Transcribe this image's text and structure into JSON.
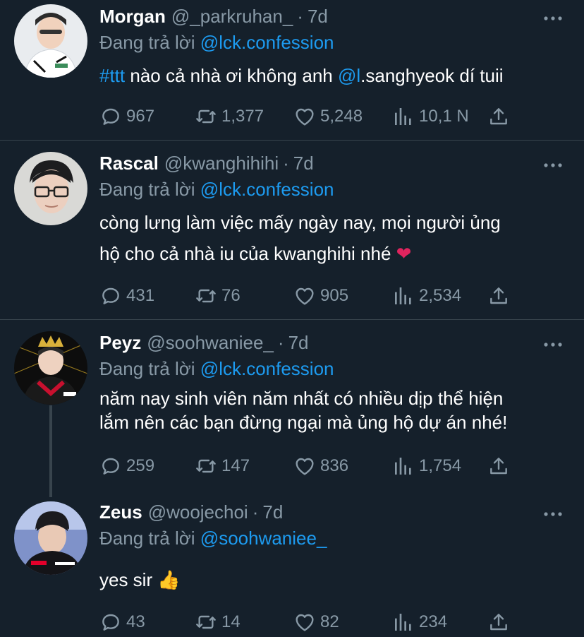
{
  "replying_prefix": "Đang trả lời",
  "tweets": [
    {
      "name": "Morgan",
      "handle": "@_parkruhan_",
      "dot": "·",
      "time": "7d",
      "replying_to": "@lck.confession",
      "text_parts": [
        "#ttt",
        " nào cả nhà ơi không anh ",
        "@l",
        ".sanghyeok dí tuii"
      ],
      "replies": "967",
      "retweets": "1,377",
      "likes": "5,248",
      "views": "10,1 N"
    },
    {
      "name": "Rascal",
      "handle": "@kwanghihihi",
      "dot": "·",
      "time": "7d",
      "replying_to": "@lck.confession",
      "text_line1": "còng lưng làm việc mấy ngày nay, mọi người ủng",
      "text_line2": "hộ cho cả nhà iu của kwanghihi nhé ",
      "emoji": "❤",
      "replies": "431",
      "retweets": "76",
      "likes": "905",
      "views": "2,534"
    },
    {
      "name": "Peyz",
      "handle": "@soohwaniee_",
      "dot": "·",
      "time": "7d",
      "replying_to": "@lck.confession",
      "text_line1": "năm nay sinh viên năm nhất có nhiều dịp thể hiện",
      "text_line2": "lắm nên các bạn đừng ngại mà ủng hộ dự án nhé!",
      "replies": "259",
      "retweets": "147",
      "likes": "836",
      "views": "1,754"
    },
    {
      "name": "Zeus",
      "handle": "@woojechoi",
      "dot": "·",
      "time": "7d",
      "replying_to": "@soohwaniee_",
      "text_line1": "yes sir ",
      "emoji": "👍",
      "replies": "43",
      "retweets": "14",
      "likes": "82",
      "views": "234"
    }
  ],
  "colors": {
    "background": "#15202b",
    "text": "#ffffff",
    "muted": "#8899a6",
    "link": "#1d9bf0",
    "divider": "#38444d"
  },
  "icons": [
    "reply-icon",
    "retweet-icon",
    "like-icon",
    "views-icon",
    "share-icon",
    "more-icon"
  ]
}
